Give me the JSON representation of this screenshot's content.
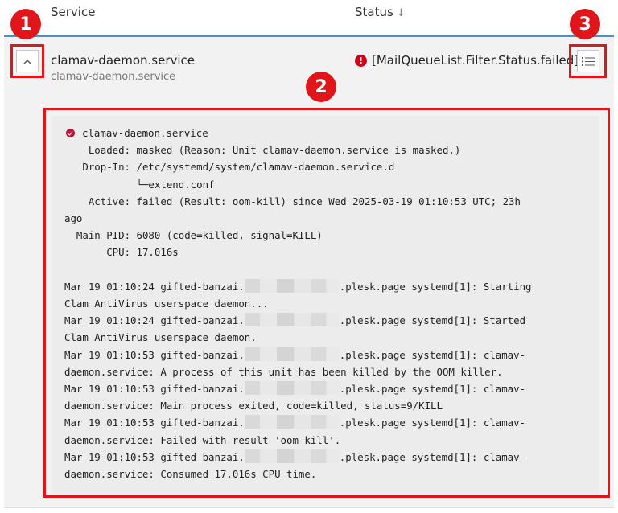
{
  "table": {
    "columns": {
      "service": "Service",
      "status": "Status"
    },
    "sort_indicator": "↓"
  },
  "row": {
    "toggle_glyph": "^",
    "service_name": "clamav-daemon.service",
    "service_subtitle": "clamav-daemon.service",
    "status_text": "[MailQueueList.Filter.Status.failed]",
    "status_icon": "!",
    "status_color": "#d0021b"
  },
  "annotations": {
    "badge1": "1",
    "badge2": "2",
    "badge3": "3",
    "color": "#e0161a"
  },
  "log": {
    "title": "clamav-daemon.service",
    "loaded": "    Loaded: masked (Reason: Unit clamav-daemon.service is masked.)",
    "dropin": "   Drop-In: /etc/systemd/system/clamav-daemon.service.d",
    "dropin_file": "            └─extend.conf",
    "active_1": "    Active: failed (Result: oom-kill) since Wed 2025-03-19 01:10:53 UTC; 23h",
    "active_2": "ago",
    "mainpid": "  Main PID: 6080 (code=killed, signal=KILL)",
    "cpu": "       CPU: 17.016s",
    "entries": [
      {
        "pre": "Mar 19 01:10:24 gifted-banzai.",
        "post": ".plesk.page systemd[1]: Starting",
        "cont": "Clam AntiVirus userspace daemon..."
      },
      {
        "pre": "Mar 19 01:10:24 gifted-banzai.",
        "post": ".plesk.page systemd[1]: Started",
        "cont": "Clam AntiVirus userspace daemon."
      },
      {
        "pre": "Mar 19 01:10:53 gifted-banzai.",
        "post": ".plesk.page systemd[1]: clamav-",
        "cont": "daemon.service: A process of this unit has been killed by the OOM killer."
      },
      {
        "pre": "Mar 19 01:10:53 gifted-banzai.",
        "post": ".plesk.page systemd[1]: clamav-",
        "cont": "daemon.service: Main process exited, code=killed, status=9/KILL"
      },
      {
        "pre": "Mar 19 01:10:53 gifted-banzai.",
        "post": ".plesk.page systemd[1]: clamav-",
        "cont": "daemon.service: Failed with result 'oom-kill'."
      },
      {
        "pre": "Mar 19 01:10:53 gifted-banzai.",
        "post": ".plesk.page systemd[1]: clamav-",
        "cont": "daemon.service: Consumed 17.016s CPU time."
      }
    ]
  }
}
